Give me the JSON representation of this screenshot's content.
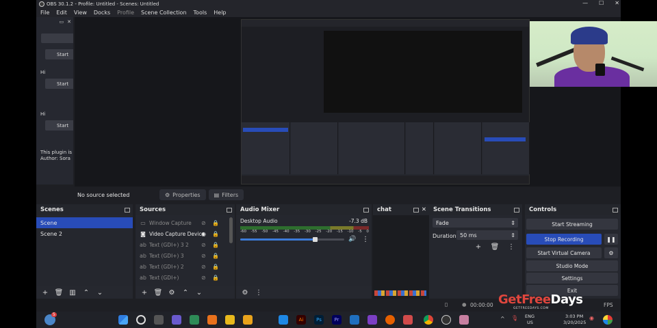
{
  "window": {
    "title": "OBS 30.1.2 - Profile: Untitled - Scenes: Untitled",
    "controls": [
      "—",
      "☐",
      "✕"
    ]
  },
  "menu": [
    "File",
    "Edit",
    "View",
    "Docks",
    "Profile",
    "Scene Collection",
    "Tools",
    "Help"
  ],
  "plugin_dock": {
    "buttons": [
      "Start",
      "Start",
      "Start"
    ],
    "labels": [
      "Hi",
      "Hi"
    ],
    "info": [
      "This plugin is",
      "Author: Sora"
    ]
  },
  "context_bar": {
    "no_source": "No source selected",
    "properties": "Properties",
    "filters": "Filters"
  },
  "scenes": {
    "title": "Scenes",
    "items": [
      "Scene",
      "Scene 2"
    ],
    "selected": 0
  },
  "sources": {
    "title": "Sources",
    "items": [
      {
        "label": "Window Capture",
        "icon": "window-icon",
        "visible": false
      },
      {
        "label": "Video Capture Device",
        "icon": "camera-icon",
        "visible": true
      },
      {
        "label": "Text (GDI+) 3 2",
        "icon": "text-icon",
        "visible": false
      },
      {
        "label": "Text (GDI+) 3",
        "icon": "text-icon",
        "visible": false
      },
      {
        "label": "Text (GDI+) 2",
        "icon": "text-icon",
        "visible": false
      },
      {
        "label": "Text (GDI+)",
        "icon": "text-icon",
        "visible": false
      }
    ]
  },
  "audio_mixer": {
    "title": "Audio Mixer",
    "channel": "Desktop Audio",
    "level": "-7.3 dB",
    "ticks": [
      "-60",
      "-55",
      "-50",
      "-45",
      "-40",
      "-35",
      "-30",
      "-25",
      "-20",
      "-15",
      "-10",
      "-5",
      "0"
    ],
    "volume_fraction": 0.72
  },
  "chat": {
    "title": "chat"
  },
  "transitions": {
    "title": "Scene Transitions",
    "selected": "Fade",
    "duration_label": "Duration",
    "duration_value": "50 ms"
  },
  "controls": {
    "title": "Controls",
    "start_streaming": "Start Streaming",
    "stop_recording": "Stop Recording",
    "virtual_camera": "Start Virtual Camera",
    "studio_mode": "Studio Mode",
    "settings": "Settings",
    "exit": "Exit"
  },
  "status": {
    "rec_time": "00:00:00",
    "fps": "FPS"
  },
  "taskbar": {
    "lang1": "ENG",
    "lang2": "US",
    "time": "3:03 PM",
    "date": "3/20/2025",
    "notif": "5"
  },
  "watermark": {
    "part1": "GetFree",
    "part2": "Days",
    "sub": "GETFREEDAYS.COM"
  },
  "colors": {
    "accent": "#284cb8",
    "dock_bg": "#26282f",
    "app_bg": "#1e1f24"
  }
}
